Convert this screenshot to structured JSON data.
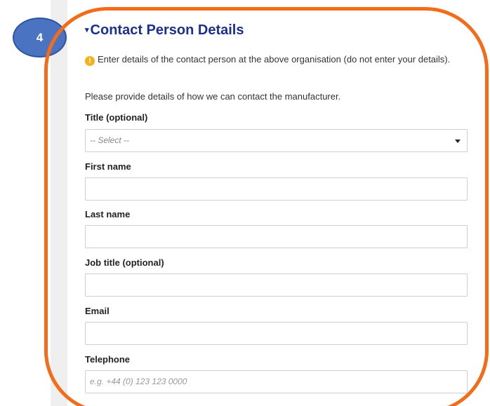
{
  "step_badge": {
    "number": "4"
  },
  "section": {
    "title": "Contact Person Details",
    "chevron": "▾"
  },
  "info": {
    "icon_glyph": "!",
    "message": "Enter details of the contact person at the above organisation (do not enter your details)."
  },
  "helper_text": "Please provide details of how we can contact the manufacturer.",
  "fields": {
    "title": {
      "label": "Title (optional)",
      "selected": "-- Select --"
    },
    "first_name": {
      "label": "First name",
      "value": ""
    },
    "last_name": {
      "label": "Last name",
      "value": ""
    },
    "job_title": {
      "label": "Job title (optional)",
      "value": ""
    },
    "email": {
      "label": "Email",
      "value": ""
    },
    "telephone": {
      "label": "Telephone",
      "placeholder": "e.g. +44 (0) 123 123 0000"
    }
  },
  "colors": {
    "accent_ring": "#f26c19",
    "badge_fill": "#4a74c2",
    "title_color": "#1b2f8f",
    "warning": "#f3b21a"
  }
}
